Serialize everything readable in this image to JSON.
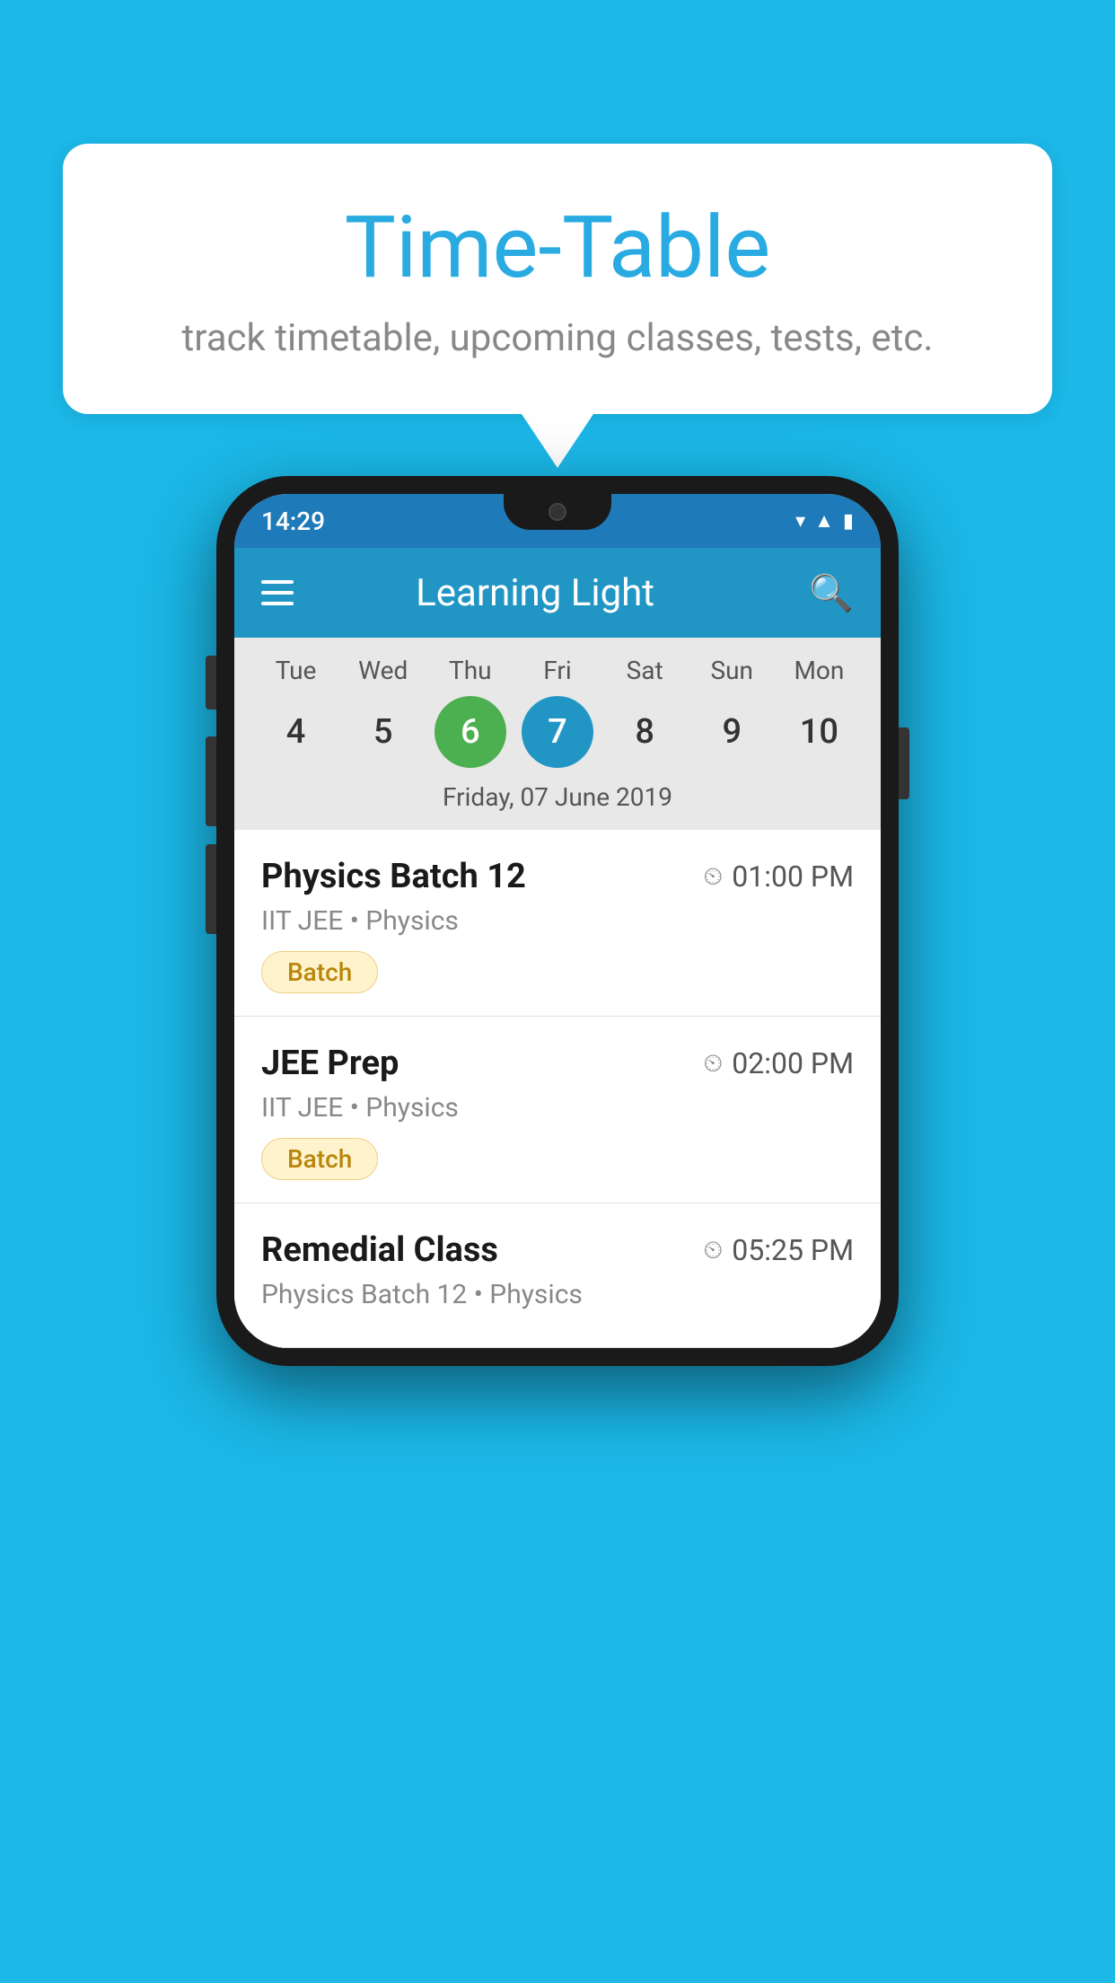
{
  "background_color": "#1bb8e8",
  "bubble": {
    "title": "Time-Table",
    "subtitle": "track timetable, upcoming classes, tests, etc."
  },
  "phone": {
    "status_bar": {
      "time": "14:29"
    },
    "app_bar": {
      "title": "Learning Light"
    },
    "calendar": {
      "days": [
        {
          "label": "Tue",
          "num": "4"
        },
        {
          "label": "Wed",
          "num": "5"
        },
        {
          "label": "Thu",
          "num": "6",
          "state": "today"
        },
        {
          "label": "Fri",
          "num": "7",
          "state": "selected"
        },
        {
          "label": "Sat",
          "num": "8"
        },
        {
          "label": "Sun",
          "num": "9"
        },
        {
          "label": "Mon",
          "num": "10"
        }
      ],
      "selected_date": "Friday, 07 June 2019"
    },
    "schedule": [
      {
        "title": "Physics Batch 12",
        "time": "01:00 PM",
        "subtitle": "IIT JEE • Physics",
        "tag": "Batch"
      },
      {
        "title": "JEE Prep",
        "time": "02:00 PM",
        "subtitle": "IIT JEE • Physics",
        "tag": "Batch"
      },
      {
        "title": "Remedial Class",
        "time": "05:25 PM",
        "subtitle": "Physics Batch 12 • Physics",
        "tag": ""
      }
    ]
  }
}
